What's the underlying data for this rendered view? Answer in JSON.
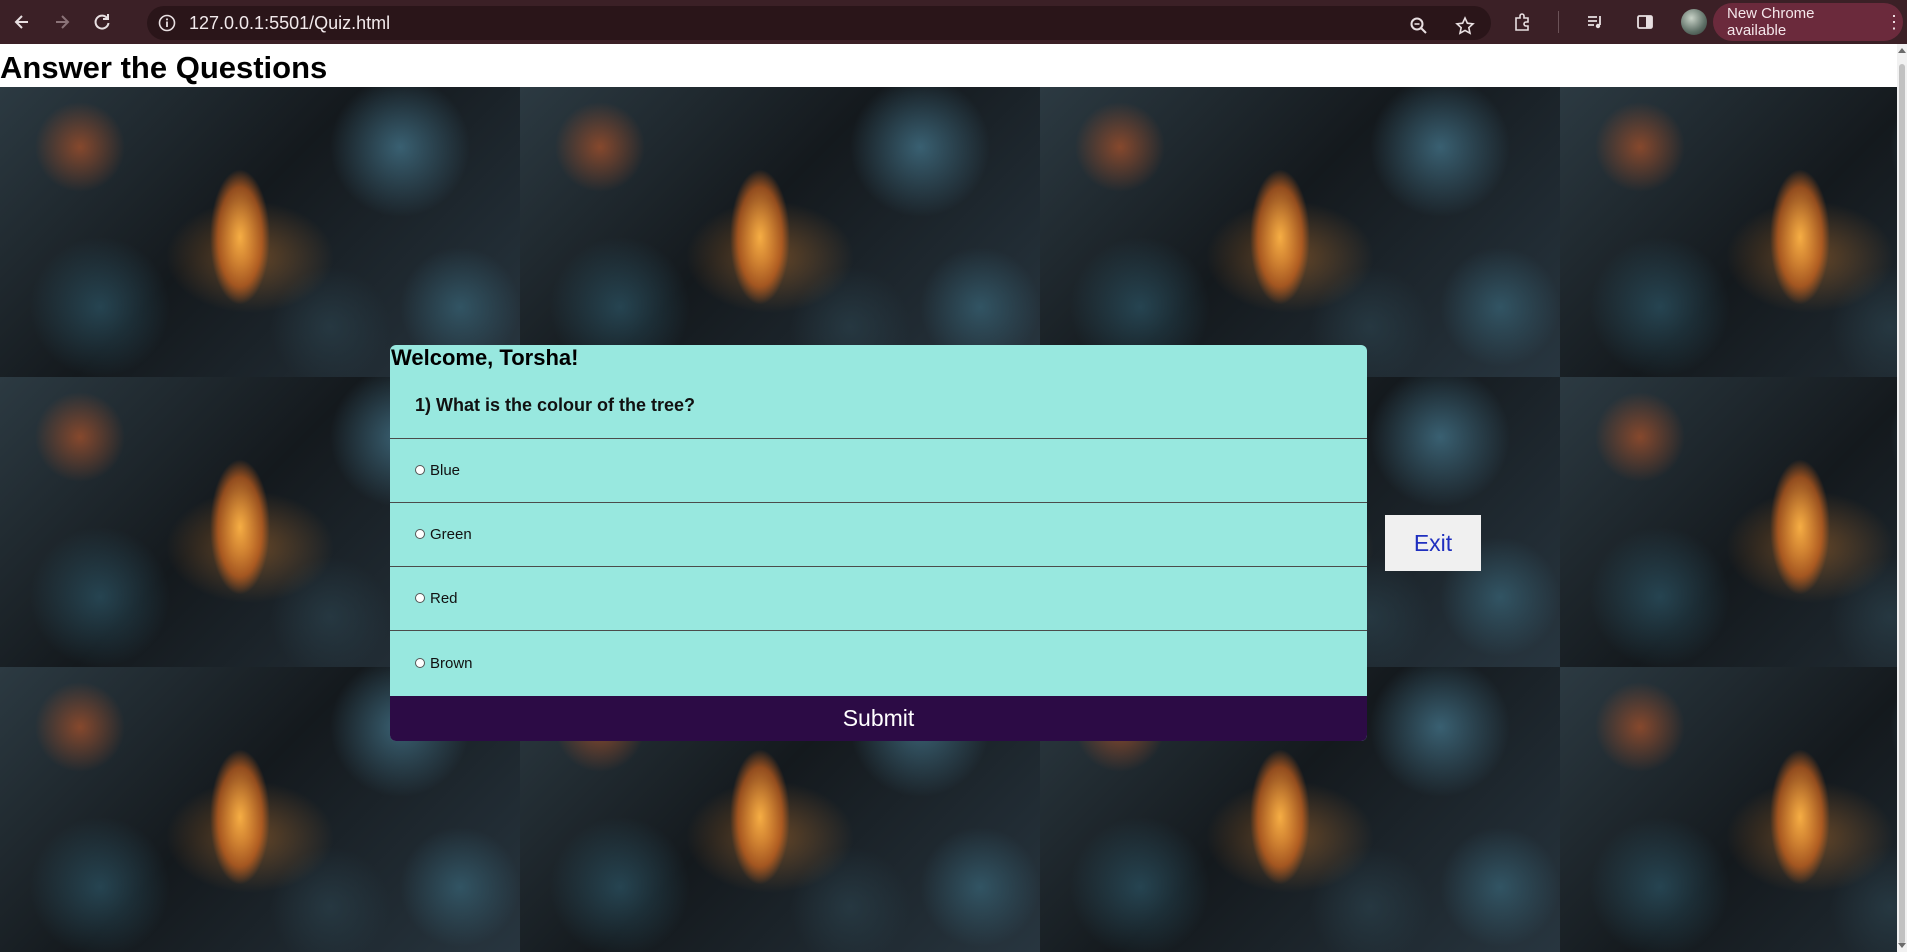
{
  "browser": {
    "url": "127.0.0.1:5501/Quiz.html",
    "update_label": "New Chrome available",
    "icons": [
      "back-icon",
      "forward-icon",
      "reload-icon",
      "site-info-icon",
      "zoom-icon",
      "star-icon",
      "extensions-icon",
      "media-icon",
      "side-panel-icon",
      "avatar",
      "menu-icon"
    ]
  },
  "page": {
    "title": "Answer the Questions"
  },
  "quiz": {
    "welcome": "Welcome, Torsha!",
    "question": "1) What is the colour of the tree?",
    "options": [
      {
        "label": "Blue"
      },
      {
        "label": "Green"
      },
      {
        "label": "Red"
      },
      {
        "label": "Brown"
      }
    ],
    "submit_label": "Submit",
    "card_color": "#98e8df",
    "submit_color": "#2c0b45"
  },
  "exit_label": "Exit"
}
